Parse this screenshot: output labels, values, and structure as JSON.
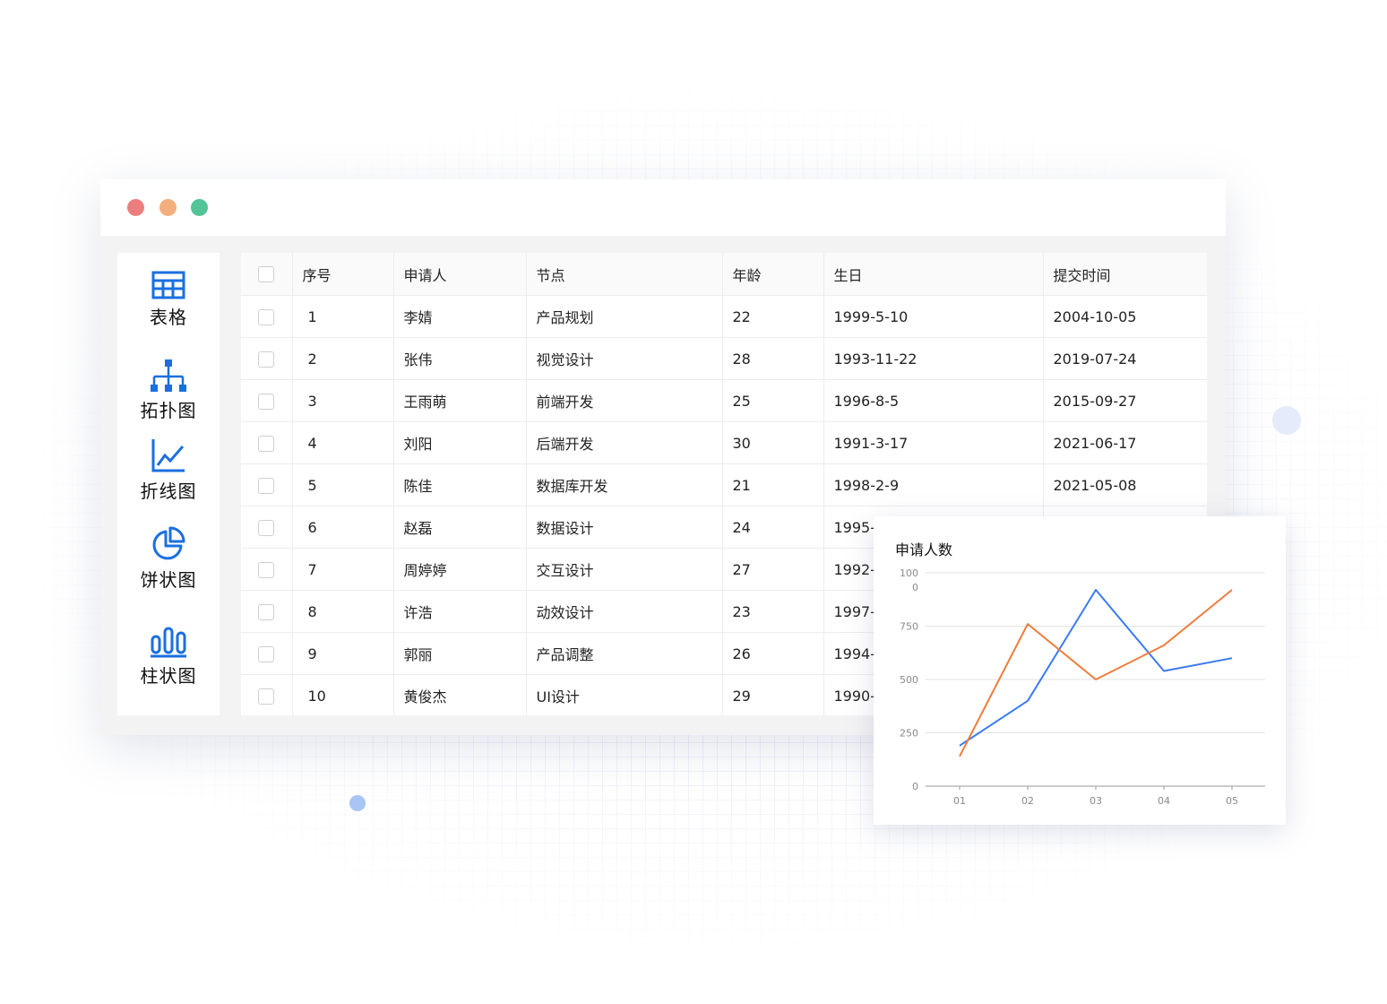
{
  "window": {
    "controls": [
      "close",
      "minimize",
      "zoom"
    ],
    "colors": {
      "close": "#ec7f7e",
      "minimize": "#f3ae7d",
      "zoom": "#53c497"
    }
  },
  "sidebar": {
    "accent": "#1a6fe0",
    "items": [
      {
        "label": "表格",
        "icon": "table-icon"
      },
      {
        "label": "拓扑图",
        "icon": "topology-icon"
      },
      {
        "label": "折线图",
        "icon": "line-chart-icon"
      },
      {
        "label": "饼状图",
        "icon": "pie-chart-icon"
      },
      {
        "label": "柱状图",
        "icon": "bar-chart-icon"
      }
    ]
  },
  "table": {
    "columns": [
      "序号",
      "申请人",
      "节点",
      "年龄",
      "生日",
      "提交时间"
    ],
    "rows": [
      [
        "1",
        "李婧",
        "产品规划",
        "22",
        "1999-5-10",
        "2004-10-05"
      ],
      [
        "2",
        "张伟",
        "视觉设计",
        "28",
        "1993-11-22",
        "2019-07-24"
      ],
      [
        "3",
        "王雨萌",
        "前端开发",
        "25",
        "1996-8-5",
        "2015-09-27"
      ],
      [
        "4",
        "刘阳",
        "后端开发",
        "30",
        "1991-3-17",
        "2021-06-17"
      ],
      [
        "5",
        "陈佳",
        "数据库开发",
        "21",
        "1998-2-9",
        "2021-05-08"
      ],
      [
        "6",
        "赵磊",
        "数据设计",
        "24",
        "1995-",
        ""
      ],
      [
        "7",
        "周婷婷",
        "交互设计",
        "27",
        "1992-",
        ""
      ],
      [
        "8",
        "许浩",
        "动效设计",
        "23",
        "1997-",
        ""
      ],
      [
        "9",
        "郭丽",
        "产品调整",
        "26",
        "1994-",
        ""
      ],
      [
        "10",
        "黄俊杰",
        "UI设计",
        "29",
        "1990-",
        ""
      ]
    ]
  },
  "chart": {
    "title": "申请人数",
    "chart_data": {
      "type": "line",
      "title": "申请人数",
      "x": [
        "01",
        "02",
        "03",
        "04",
        "05"
      ],
      "yticks": [
        {
          "value": 0,
          "lines": [
            "0"
          ]
        },
        {
          "value": 250,
          "lines": [
            "250"
          ]
        },
        {
          "value": 500,
          "lines": [
            "500"
          ]
        },
        {
          "value": 750,
          "lines": [
            "750"
          ]
        },
        {
          "value": 1000,
          "lines": [
            "100",
            "0"
          ]
        }
      ],
      "ylim": [
        0,
        1000
      ],
      "grid": true,
      "legend": "none",
      "series": [
        {
          "values": [
            190,
            400,
            920,
            540,
            600
          ],
          "color": "#3a7bf0"
        },
        {
          "values": [
            140,
            760,
            500,
            660,
            920
          ],
          "color": "#ee7c3b"
        }
      ]
    }
  }
}
